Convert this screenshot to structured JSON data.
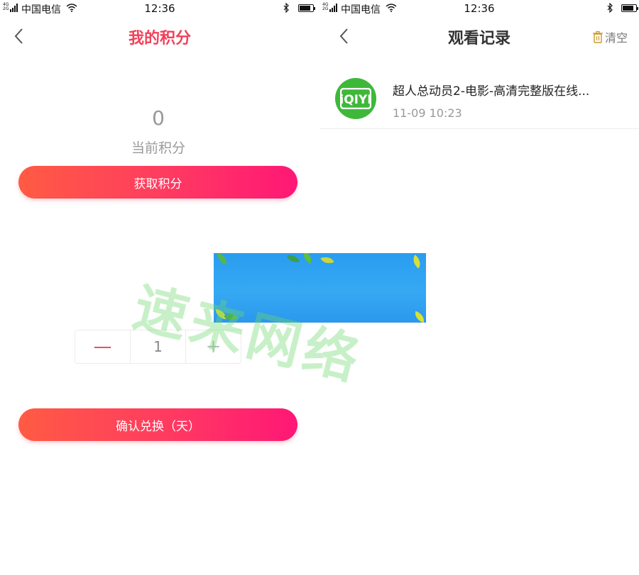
{
  "status_bar": {
    "network_top": "4G",
    "network_bottom": "2G",
    "carrier": "中国电信",
    "time": "12:36"
  },
  "left": {
    "title": "我的积分",
    "points_value": "0",
    "points_label": "当前积分",
    "get_points_label": "获取积分",
    "quantity": "1",
    "minus_glyph": "—",
    "plus_glyph": "+",
    "confirm_label": "确认兑换（天）"
  },
  "right": {
    "title": "观看记录",
    "clear_label": "清空",
    "history": [
      {
        "title": "超人总动员2-电影-高清完整版在线...",
        "time": "11-09 10:23",
        "app_icon": "iqiyi-logo"
      }
    ]
  },
  "watermark": {
    "text": "速来网络"
  },
  "colors": {
    "accent_title": "#f2405a",
    "button_gradient_start": "#ff5b43",
    "button_gradient_end": "#ff1776",
    "iqiyi_green": "#3fb83a",
    "banner_blue": "#2a9cf0"
  }
}
